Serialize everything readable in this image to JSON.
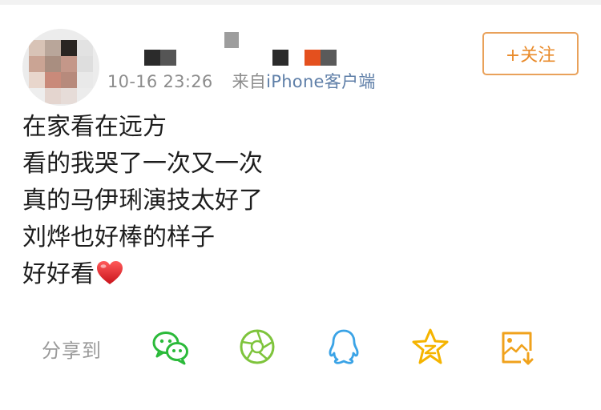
{
  "post": {
    "meta": {
      "timestamp": "10-16 23:26",
      "source_prefix": "来自",
      "source": "iPhone客户端"
    },
    "follow_label": "+关注",
    "content_lines": [
      "在家看在远方",
      "看的我哭了一次又一次",
      "真的马伊琍演技太好了",
      "刘烨也好棒的样子",
      "好好看"
    ],
    "content_emoji": "heart"
  },
  "share": {
    "label": "分享到",
    "targets": [
      {
        "icon": "wechat-icon",
        "color": "#2bba3a"
      },
      {
        "icon": "moments-icon",
        "color": "#7ec43c"
      },
      {
        "icon": "qq-icon",
        "color": "#3aa3e6"
      },
      {
        "icon": "qzone-star-icon",
        "color": "#f5b400"
      },
      {
        "icon": "save-image-icon",
        "color": "#f0a21c"
      }
    ]
  },
  "colors": {
    "accent": "#e98b2b",
    "meta_text": "#8c8c8c",
    "source_link": "#5f7fa8",
    "heart": "#e0242b"
  }
}
